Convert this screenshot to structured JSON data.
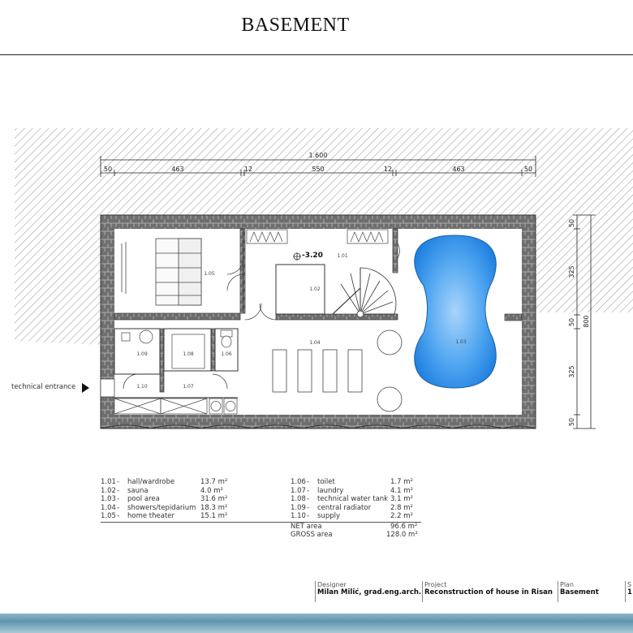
{
  "page_title": "BASEMENT",
  "dimensions": {
    "overall_width": "1.600",
    "segments": [
      "50",
      "463",
      "12",
      "550",
      "12",
      "463",
      "50"
    ],
    "side_segments": [
      "50",
      "325",
      "50",
      "325",
      "50"
    ],
    "overall_height": "800"
  },
  "level_mark": "-3.20",
  "rooms": {
    "r101": "1.01",
    "r102": "1.02",
    "r103": "1.03",
    "r104": "1.04",
    "r105": "1.05",
    "r106": "1.06",
    "r107": "1.07",
    "r108": "1.08",
    "r109": "1.09",
    "r110": "1.10"
  },
  "entrance_label": "technical entrance",
  "legend_left": [
    {
      "code": "1.01",
      "name": "hall/wardrobe",
      "area": "13.7 m²"
    },
    {
      "code": "1.02",
      "name": "sauna",
      "area": "4.0 m²"
    },
    {
      "code": "1.03",
      "name": "pool area",
      "area": "31.6 m²"
    },
    {
      "code": "1.04",
      "name": "showers/tepidarium",
      "area": "18.3 m²"
    },
    {
      "code": "1.05",
      "name": "home theater",
      "area": "15.1 m²"
    }
  ],
  "legend_right": [
    {
      "code": "1.06",
      "name": "toilet",
      "area": "1.7 m²"
    },
    {
      "code": "1.07",
      "name": "laundry",
      "area": "4.1 m²"
    },
    {
      "code": "1.08",
      "name": "technical water tank",
      "area": "3.1 m²"
    },
    {
      "code": "1.09",
      "name": "central radiator",
      "area": "2.8 m²"
    },
    {
      "code": "1.10",
      "name": "supply",
      "area": "2.2 m²"
    }
  ],
  "totals": [
    {
      "label": "NET area",
      "value": "96.6 m²"
    },
    {
      "label": "GROSS area",
      "value": "128.0 m²"
    }
  ],
  "title_block": {
    "designer_label": "Designer",
    "designer": "Milan Milić, grad.eng.arch.",
    "project_label": "Project",
    "project": "Reconstruction of house in Risan",
    "plan_label": "Plan",
    "plan": "Basement",
    "scale_label": "S",
    "scale": "1"
  },
  "colors": {
    "pool": "#2f8fe6",
    "wall": "#5a5a5a",
    "footer": "#6ea3ba"
  }
}
